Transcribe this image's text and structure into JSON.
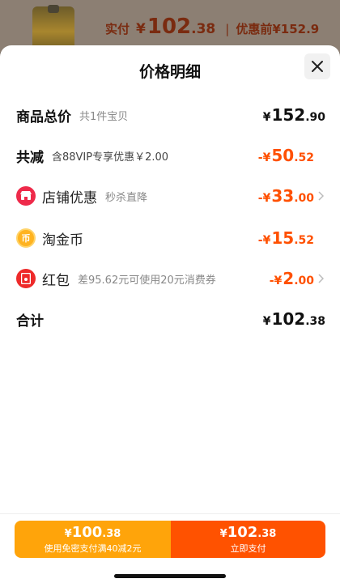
{
  "background": {
    "price_label": "实付",
    "currency": "¥",
    "price_int": "102",
    "price_dec": ".38",
    "separator": "|",
    "before_label": "优惠前",
    "before_price": "¥152.9"
  },
  "sheet": {
    "title": "价格明细"
  },
  "rows": {
    "total": {
      "title": "商品总价",
      "sub": "共1件宝贝",
      "currency": "¥",
      "int": "152",
      "dec": ".90"
    },
    "reduce": {
      "title": "共减",
      "sub": "含88VIP专享优惠￥2.00",
      "currency": "-¥",
      "int": "50",
      "dec": ".52"
    },
    "shop": {
      "name": "店铺优惠",
      "sub": "秒杀直降",
      "currency": "-¥",
      "int": "33",
      "dec": ".00",
      "icon": "shop-icon"
    },
    "coin": {
      "name": "淘金币",
      "currency": "-¥",
      "int": "15",
      "dec": ".52",
      "icon": "coin-icon"
    },
    "redpacket": {
      "name": "红包",
      "sub": "差95.62元可使用20元消费券",
      "currency": "-¥",
      "int": "2",
      "dec": ".00",
      "icon": "red-packet-icon"
    },
    "sum": {
      "title": "合计",
      "currency": "¥",
      "int": "102",
      "dec": ".38"
    }
  },
  "buttons": {
    "left": {
      "currency": "¥",
      "int": "100",
      "dec": ".38",
      "sub": "使用免密支付满40减2元"
    },
    "right": {
      "currency": "¥",
      "int": "102",
      "dec": ".38",
      "sub": "立即支付"
    }
  },
  "colors": {
    "accent": "#ff5000",
    "left_button": "#ffa40a",
    "right_button": "#ff5200"
  }
}
